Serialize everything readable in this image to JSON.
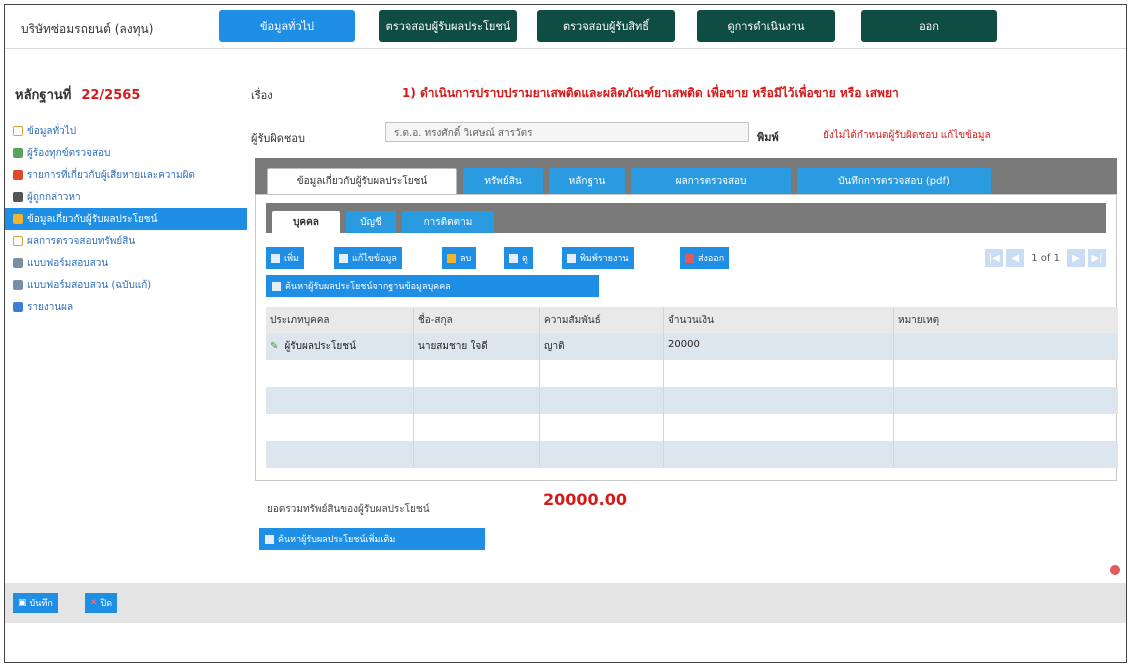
{
  "header": {
    "title": "บริษัทซ่อมรถยนต์ (ลงทุน)",
    "nav": [
      "ข้อมูลทั่วไป",
      "ตรวจสอบผู้รับผลประโยชน์",
      "ตรวจสอบผู้รับสิทธิ์",
      "ดูการดำเนินงาน",
      "ออก"
    ]
  },
  "sidebar": {
    "case_label": "หลักฐานที่",
    "case_number": "22/2565",
    "items": [
      "ข้อมูลทั่วไป",
      "ผู้ร้องทุกข์ตรวจสอบ",
      "รายการที่เกี่ยวกับผู้เสียหายและความผิด",
      "ผู้ถูกกล่าวหา",
      "ข้อมูลเกี่ยวกับผู้รับผลประโยชน์",
      "ผลการตรวจสอบทรัพย์สิน",
      "แบบฟอร์มสอบสวน",
      "แบบฟอร์มสอบสวน (ฉบับแก้)",
      "รายงานผล"
    ]
  },
  "main": {
    "subject_label": "เรื่อง",
    "subject_value": "1) ดำเนินการปราบปรามยาเสพติดและผลิตภัณฑ์ยาเสพติด เพื่อขาย หรือมีไว้เพื่อขาย หรือ เสพยา",
    "field_label": "ผู้รับผิดชอบ",
    "field_value": "ร.ต.อ. ทรงศักดิ์ วิเศษณ์ สารวัตร",
    "print_label": "พิมพ์",
    "print_value": "ยังไม่ได้กำหนดผู้รับผิดชอบ แก้ไขข้อมูล",
    "tabs": [
      "ข้อมูลเกี่ยวกับผู้รับผลประโยชน์",
      "ทรัพย์สิน",
      "หลักฐาน",
      "ผลการตรวจสอบ",
      "บันทึกการตรวจสอบ (pdf)"
    ],
    "subtabs": [
      "บุคคล",
      "บัญชี",
      "การติดตาม"
    ],
    "toolbar": [
      "เพิ่ม",
      "แก้ไขข้อมูล",
      "ลบ",
      "ดู",
      "พิมพ์รายงาน",
      "ส่งออก"
    ],
    "wide_button": "ค้นหาผู้รับผลประโยชน์จากฐานข้อมูลบุคคล",
    "pager": {
      "text": "1 of 1",
      "first": "|◀",
      "prev": "◀",
      "next": "▶",
      "last": "▶|"
    },
    "grid": {
      "columns": [
        "ประเภทบุคคล",
        "ชื่อ-สกุล",
        "ความสัมพันธ์",
        "จำนวนเงิน",
        "หมายเหตุ"
      ],
      "rows": [
        [
          "ผู้รับผลประโยชน์",
          "นายสมชาย ใจดี",
          "ญาติ",
          "20000",
          ""
        ]
      ]
    },
    "total_label": "ยอดรวมทรัพย์สินของผู้รับผลประโยชน์",
    "total_value": "20000.00",
    "bottom_button": "ค้นหาผู้รับผลประโยชน์เพิ่มเติม"
  },
  "footer": {
    "save": "บันทึก",
    "close": "ปิด"
  }
}
